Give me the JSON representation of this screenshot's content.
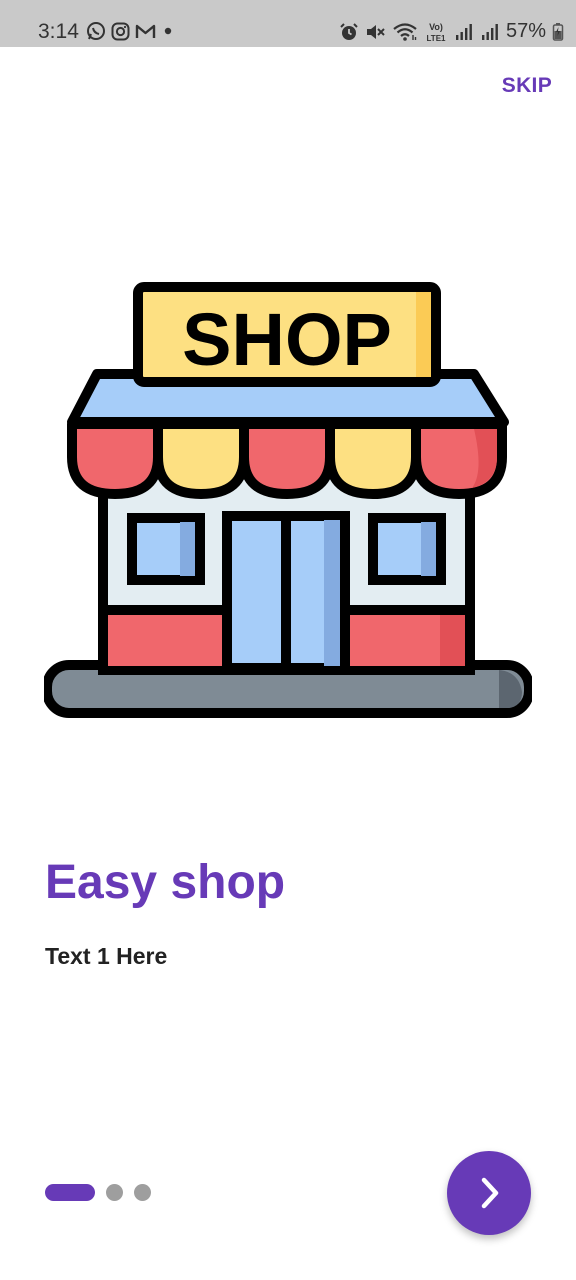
{
  "status_bar": {
    "time": "3:14",
    "battery_percent": "57%",
    "left_icons": [
      "whatsapp-icon",
      "instagram-icon",
      "gmail-icon",
      "dot-icon"
    ],
    "right_icons": [
      "alarm-icon",
      "mute-icon",
      "wifi-icon",
      "volte-icon",
      "signal-icon",
      "signal-icon",
      "battery-icon"
    ],
    "volte_label_top": "Vo)",
    "volte_label_bottom": "LTE1"
  },
  "header": {
    "skip_label": "SKIP"
  },
  "illustration": {
    "icon": "shop-icon",
    "sign_text": "SHOP"
  },
  "content": {
    "title": "Easy shop",
    "subtitle": "Text 1 Here"
  },
  "pager": {
    "page_count": 3,
    "current_page": 1
  },
  "colors": {
    "accent": "#673ab7",
    "inactive_dot": "#9e9e9e",
    "status_bar": "#c9c9c9"
  },
  "next_button": {
    "icon": "chevron-right-icon"
  }
}
